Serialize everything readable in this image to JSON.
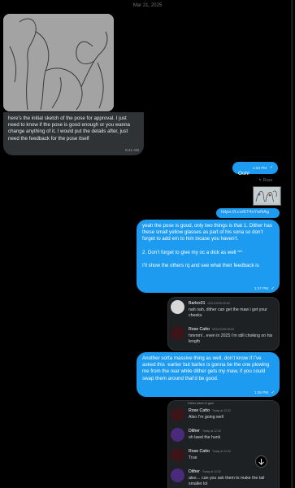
{
  "date": "Mar 21, 2025",
  "message1": {
    "text": "here’s the initial sketch of the pose for approval. I just need to know if the pose is good enough or you wanna change anything of it. I would put the details after, just need the feedback for the pose itself",
    "time": "6:41 AM"
  },
  "message2": {
    "text": "Ooh!",
    "time": "1:03 PM"
  },
  "reply_label": "Rose",
  "link_text": "https://t.co/ET4sYwNAg",
  "message3": {
    "text": "yeah the pose is good, only two things is that 1. Dither has these small yellow glasses as part of his sona so don’t forget to add em to him incase you haven’t.\n\n2. Don’t forget to give my oc a dick as well ^^\n\nI’ll show the others rq and see what their feedback is",
    "time": "1:17 PM"
  },
  "quote1": [
    {
      "name": "Barlex01",
      "meta": "03/21/2025 00:00",
      "text": "nah nah, dither can get the maw i get your cheeks"
    },
    {
      "name": "Rose Catto",
      "meta": "03/21/2025 00:00",
      "text": "hmmm!.. even in 2025 I’m still choking on his length"
    }
  ],
  "message4": {
    "text": "Another sorta massive thing as well, don’t know if I’ve asked this  earlier but barlex is gonna be the one plowing me from the rear while dither gets my maw, if you could swap them around that’d be good.",
    "time": "1:25 PM"
  },
  "quote2": {
    "header": "Dither  taken 8 gam",
    "messages": [
      {
        "name": "Rose Catto",
        "meta": "Today at 12:32",
        "text": "Also I’m going well"
      },
      {
        "name": "Dither",
        "meta": "Today at 12:32",
        "text": "oh lawd the hunk"
      },
      {
        "name": "Rose Catto",
        "meta": "Today at 12:32",
        "text": "True"
      },
      {
        "name": "Dither",
        "meta": "Today at 12:32",
        "text": "also… can you ask them to make the tail smaller lol"
      }
    ]
  },
  "icons": {
    "scroll": "arrow-down-icon",
    "read": "check-circle-icon",
    "reply": "reply-icon"
  }
}
